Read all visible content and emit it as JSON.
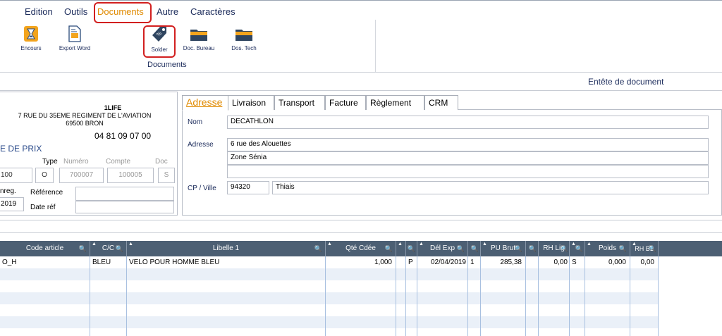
{
  "menu": {
    "items": [
      "Edition",
      "Outils",
      "Documents",
      "Autre",
      "Caractères"
    ],
    "active": "Documents"
  },
  "ribbon": {
    "buttons": [
      {
        "label": "Encours",
        "icon": "hourglass-icon"
      },
      {
        "label": "Export Word",
        "icon": "word-export-icon"
      },
      {
        "label": "Solder",
        "icon": "price-tag-icon"
      },
      {
        "label": "Doc. Bureau",
        "icon": "folder-icon"
      },
      {
        "label": "Dos. Tech",
        "icon": "folder-icon"
      }
    ],
    "group_label": "Documents"
  },
  "header_strip": {
    "title": "Entête de document"
  },
  "company": {
    "name": "1LIFE",
    "address1": "7 RUE DU 35EME REGIMENT DE L'AVIATION",
    "address2": "69500 BRON",
    "phone": "04 81 09 07 00",
    "doc_type_title": "E DE PRIX"
  },
  "doc_fields": {
    "type_label": "Type",
    "numero_label": "Numéro",
    "compte_label": "Compte",
    "doc_label": "Doc",
    "first_value": "100",
    "type_value": "O",
    "numero_value": "700007",
    "compte_value": "100005",
    "doc_value": "S",
    "enreg_label": "nreg.",
    "enreg_value": "2019",
    "reference_label": "Référence",
    "reference_value": "",
    "date_ref_label": "Date réf",
    "date_ref_value": ""
  },
  "tabs": [
    "Adresse",
    "Livraison",
    "Transport",
    "Facture",
    "Règlement",
    "CRM"
  ],
  "active_tab": "Adresse",
  "address": {
    "nom_label": "Nom",
    "nom_value": "DECATHLON",
    "adresse_label": "Adresse",
    "adresse_line1": "6 rue des Alouettes",
    "adresse_line2": "Zone Sénia",
    "adresse_line3": "",
    "cp_label": "CP / Ville",
    "cp_value": "94320",
    "ville_value": "Thiais"
  },
  "grid": {
    "columns": [
      "Code article",
      "C/C",
      "Libelle 1",
      "Qté Cdée",
      "",
      "Dél Exp",
      "",
      "PU Brut",
      "",
      "RH Lig",
      "",
      "Poids",
      "RH B1"
    ],
    "rows": [
      [
        "O_H",
        "BLEU",
        "VELO POUR HOMME BLEU",
        "1,000",
        "P",
        "02/04/2019",
        "1",
        "285,38",
        "",
        "0,00",
        "S",
        "0,000",
        "0,00"
      ]
    ]
  }
}
